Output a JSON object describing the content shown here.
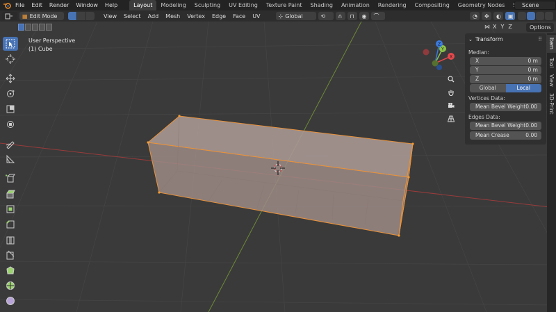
{
  "menu": {
    "items": [
      "File",
      "Edit",
      "Render",
      "Window",
      "Help"
    ]
  },
  "workspaces": {
    "tabs": [
      "Layout",
      "Modeling",
      "Sculpting",
      "UV Editing",
      "Texture Paint",
      "Shading",
      "Animation",
      "Rendering",
      "Compositing",
      "Geometry Nodes",
      "Scripting"
    ],
    "active": "Layout"
  },
  "scene": {
    "name": "Scene"
  },
  "header": {
    "mode": "Edit Mode",
    "menus": [
      "View",
      "Select",
      "Add",
      "Mesh",
      "Vertex",
      "Edge",
      "Face",
      "UV"
    ],
    "orientation": "Global"
  },
  "subheader": {
    "axes": [
      "X",
      "Y",
      "Z"
    ],
    "options": "Options"
  },
  "viewport": {
    "perspective": "User Perspective",
    "object": "(1) Cube"
  },
  "npanel": {
    "title": "Transform",
    "median_label": "Median:",
    "x_label": "X",
    "x_value": "0 m",
    "y_label": "Y",
    "y_value": "0 m",
    "z_label": "Z",
    "z_value": "0 m",
    "global": "Global",
    "local": "Local",
    "vertices_label": "Vertices Data:",
    "vertex_bevel_label": "Mean Bevel Weight",
    "vertex_bevel_value": "0.00",
    "edges_label": "Edges Data:",
    "edge_bevel_label": "Mean Bevel Weight",
    "edge_bevel_value": "0.00",
    "crease_label": "Mean Crease",
    "crease_value": "0.00"
  },
  "sidetabs": [
    "Item",
    "Tool",
    "View",
    "3D-Print"
  ],
  "gizmo": {
    "x": "X",
    "y": "Y",
    "z": "Z"
  },
  "colors": {
    "accent": "#4772b3",
    "selection": "#f39c37",
    "x_axis": "#e5484d",
    "y_axis": "#8bc34a",
    "z_axis": "#3a7be0"
  }
}
